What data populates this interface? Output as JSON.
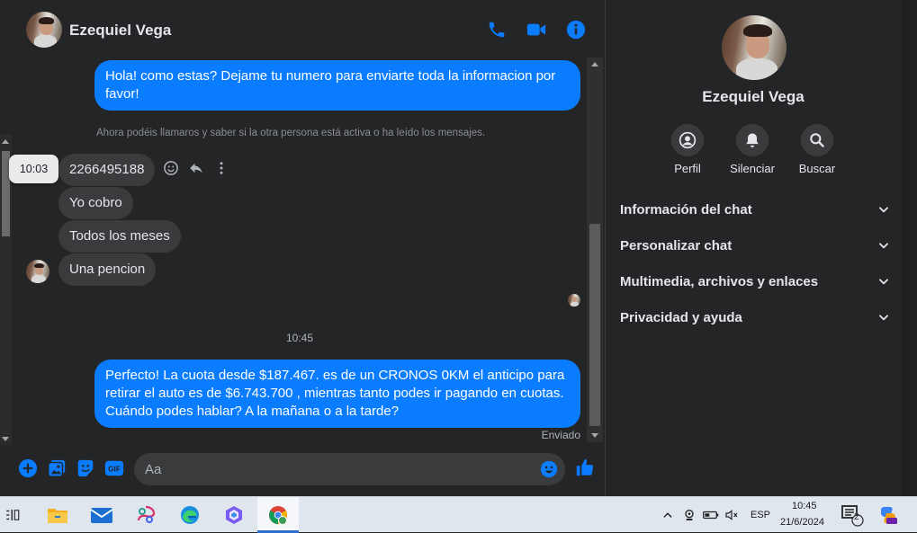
{
  "header": {
    "contact_name": "Ezequiel Vega",
    "icons": [
      "phone-icon",
      "video-icon",
      "info-icon"
    ]
  },
  "messages": {
    "first_outgoing": "Hola! como estas? Dejame tu numero para enviarte toda la informacion por favor!",
    "system_note": "Ahora podéis llamaros y saber si la otra persona está activa o ha leído los mensajes.",
    "hover_time": "10:03",
    "incoming": [
      "2266495188",
      "Yo cobro",
      "Todos los meses",
      "Una pencion"
    ],
    "center_time": "10:45",
    "last_outgoing": "Perfecto! La cuota desde $187.467. es de un CRONOS 0KM el anticipo para retirar el auto es de $6.743.700 , mientras tanto podes ir pagando en cuotas. Cuándo podes hablar? A la mañana o a la tarde?",
    "status": "Enviado"
  },
  "composer": {
    "placeholder": "Aa",
    "icons": [
      "plus-icon",
      "image-icon",
      "sticker-icon",
      "gif-icon",
      "emoji-icon",
      "like-icon"
    ],
    "gif_label": "GIF"
  },
  "info": {
    "name": "Ezequiel Vega",
    "actions": [
      {
        "label": "Perfil",
        "icon": "profile-icon"
      },
      {
        "label": "Silenciar",
        "icon": "bell-icon"
      },
      {
        "label": "Buscar",
        "icon": "search-icon"
      }
    ],
    "sections": [
      "Información del chat",
      "Personalizar chat",
      "Multimedia, archivos y enlaces",
      "Privacidad y ayuda"
    ]
  },
  "taskbar": {
    "lang": "ESP",
    "time": "10:45",
    "date": "21/6/2024",
    "notification_count": "2"
  },
  "colors": {
    "accent": "#0a7cff",
    "background": "#242526",
    "incoming_bubble": "#3a3b3c"
  }
}
